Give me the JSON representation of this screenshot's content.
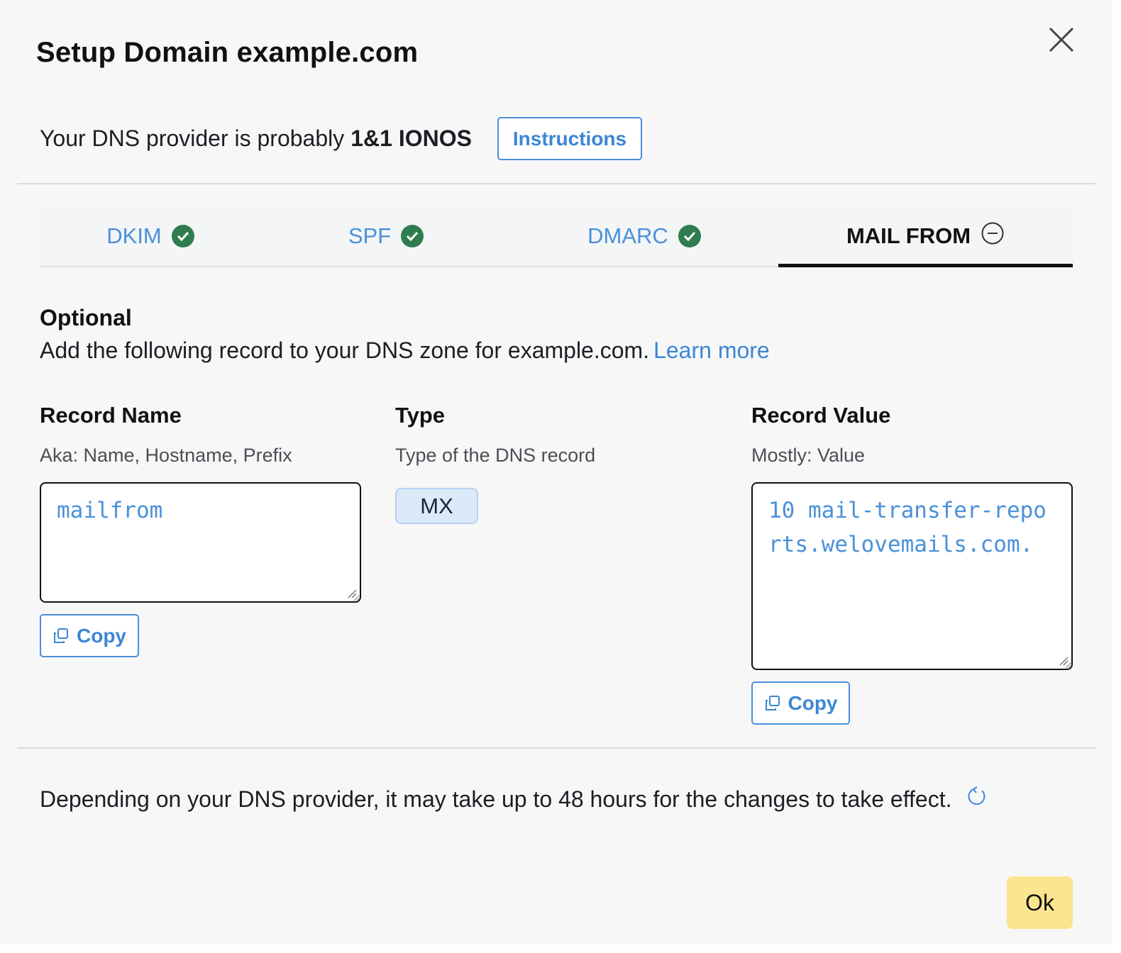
{
  "dialog": {
    "title": "Setup Domain example.com",
    "close_icon": "close-icon"
  },
  "provider": {
    "prefix": "Your DNS provider is probably",
    "name": "1&1 IONOS",
    "instructions_label": "Instructions"
  },
  "tabs": [
    {
      "label": "DKIM",
      "status": "verified",
      "icon": "check-circle-icon"
    },
    {
      "label": "SPF",
      "status": "verified",
      "icon": "check-circle-icon"
    },
    {
      "label": "DMARC",
      "status": "verified",
      "icon": "check-circle-icon"
    },
    {
      "label": "MAIL FROM",
      "status": "optional",
      "icon": "minus-circle-icon",
      "active": true
    }
  ],
  "section": {
    "heading": "Optional",
    "description": "Add the following record to your DNS zone for example.com.",
    "learn_more": "Learn more"
  },
  "record_name": {
    "heading": "Record Name",
    "subtext": "Aka: Name, Hostname, Prefix",
    "value": "mailfrom",
    "copy_label": "Copy"
  },
  "record_type": {
    "heading": "Type",
    "subtext": "Type of the DNS record",
    "value": "MX"
  },
  "record_value": {
    "heading": "Record Value",
    "subtext": "Mostly: Value",
    "value": "10 mail-transfer-reports.welovemails.com.",
    "copy_label": "Copy"
  },
  "footer": {
    "note": "Depending on your DNS provider, it may take up to 48 hours for the changes to take effect.",
    "refresh_icon": "refresh-icon",
    "ok_label": "Ok"
  },
  "colors": {
    "accent": "#4a90d9",
    "success": "#2f7d4f",
    "ok_button": "#fbe58e",
    "badge_bg": "#dbe9f8"
  }
}
